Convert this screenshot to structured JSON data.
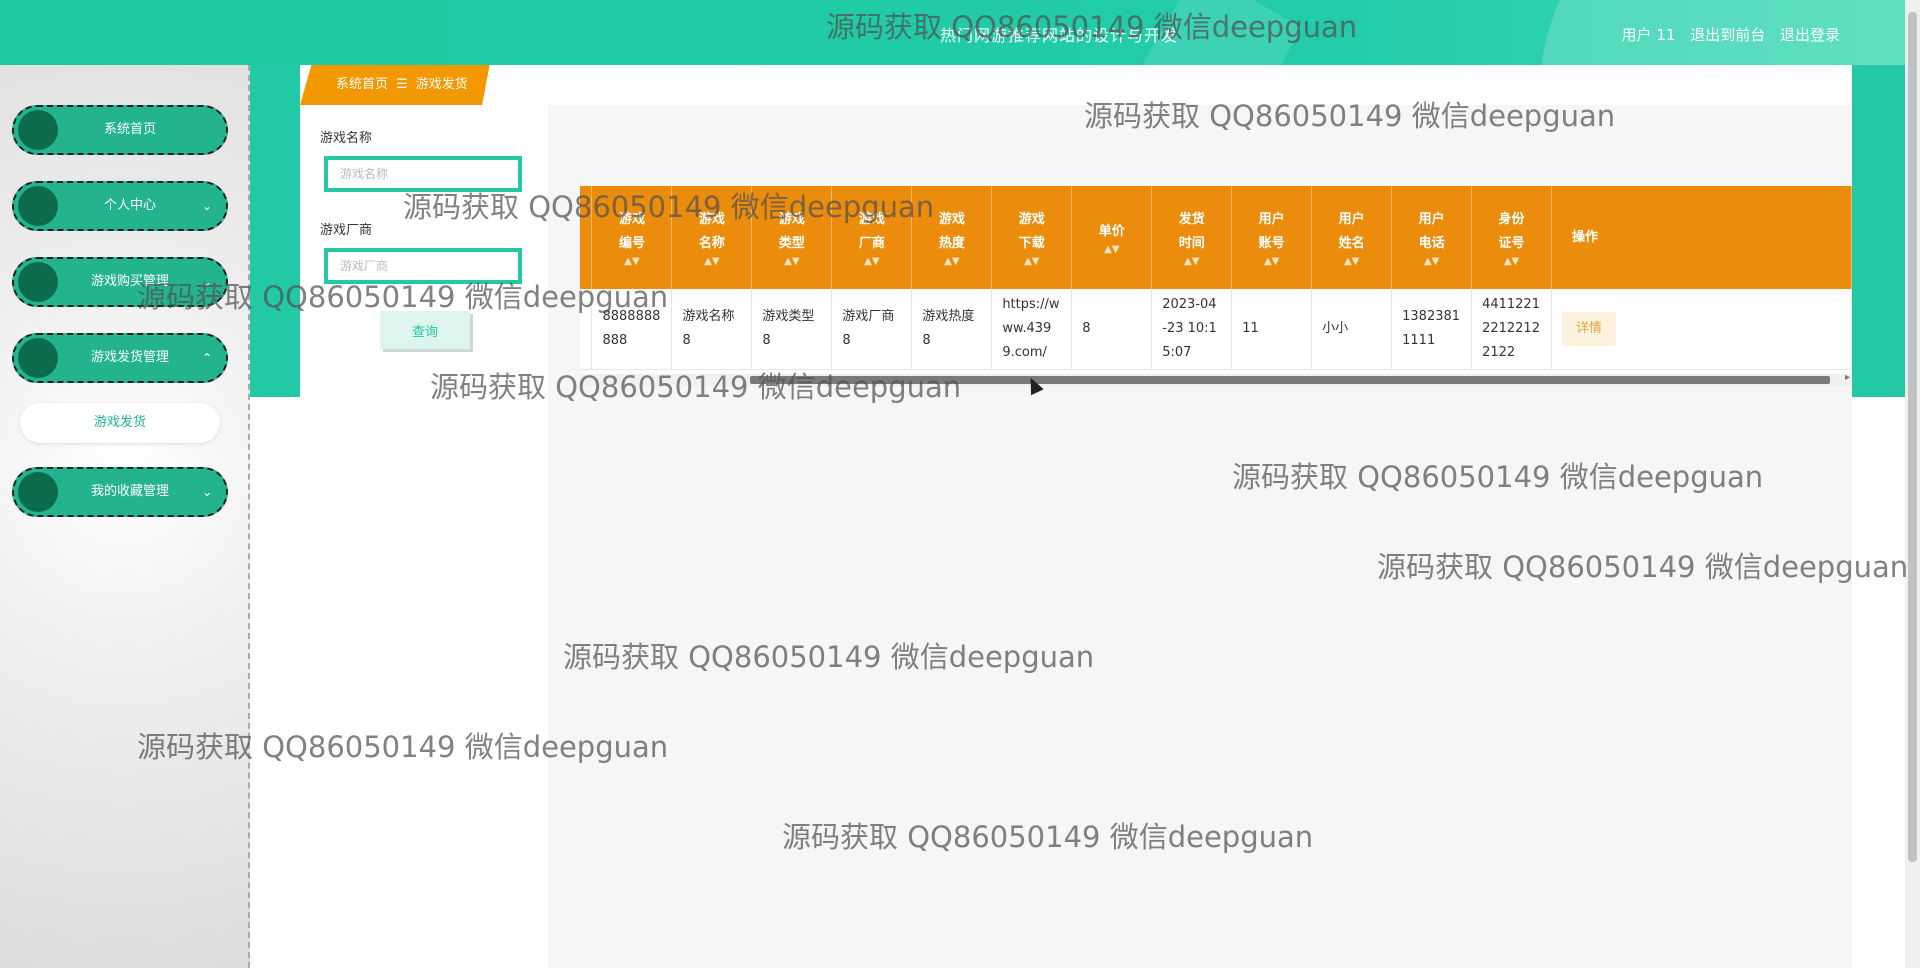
{
  "header": {
    "site_title": "热门网游推荐网站的设计与开发",
    "user_label": "用户 11",
    "back_to_front": "退出到前台",
    "logout": "退出登录"
  },
  "sidebar": {
    "items": [
      {
        "label": "系统首页",
        "chevron": ""
      },
      {
        "label": "个人中心",
        "chevron": "⌄"
      },
      {
        "label": "游戏购买管理",
        "chevron": "⌄"
      },
      {
        "label": "游戏发货管理",
        "chevron": "⌃"
      },
      {
        "label": "我的收藏管理",
        "chevron": "⌄"
      }
    ],
    "active_sub": "游戏发货"
  },
  "breadcrumb": {
    "home": "系统首页",
    "separator": "☰",
    "current": "游戏发货"
  },
  "search": {
    "name_label": "游戏名称",
    "name_placeholder": "游戏名称",
    "vendor_label": "游戏厂商",
    "vendor_placeholder": "游戏厂商",
    "query_button": "查询"
  },
  "table": {
    "columns": [
      "游戏\n编号",
      "游戏\n名称",
      "游戏\n类型",
      "游戏\n厂商",
      "游戏\n热度",
      "游戏\n下载",
      "单价",
      "发货\n时间",
      "用户\n账号",
      "用户\n姓名",
      "用户\n电话",
      "身份\n证号",
      "操作"
    ],
    "sort_icon": "▲▼",
    "rows": [
      [
        "8888888888",
        "游戏名称8",
        "游戏类型8",
        "游戏厂商8",
        "游戏热度8",
        "https://www.4399.com/",
        "8",
        "2023-04-23 10:15:07",
        "11",
        "小小",
        "13823811111",
        "441122122122122122",
        ""
      ]
    ],
    "detail_button": "详情"
  },
  "watermark": "源码获取 QQ86050149 微信deepguan"
}
